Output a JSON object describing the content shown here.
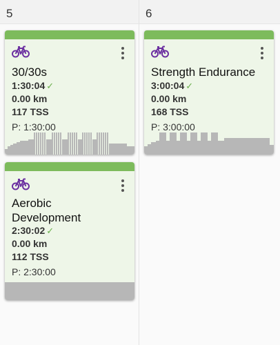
{
  "days": [
    {
      "label": "5"
    },
    {
      "label": "6"
    }
  ],
  "colors": {
    "accent": "#7dbb5c",
    "icon": "#6b2fa0",
    "check": "#6ab04c",
    "chart": "#b7b7b7"
  },
  "workouts": [
    {
      "icon": "bike-icon",
      "title": "30/30s",
      "duration": "1:30:04",
      "distance": "0.00 km",
      "tss": "117 TSS",
      "planned": "P: 1:30:00"
    },
    {
      "icon": "bike-icon",
      "title": "Strength Endurance",
      "duration": "3:00:04",
      "distance": "0.00 km",
      "tss": "168 TSS",
      "planned": "P: 3:00:00"
    },
    {
      "icon": "bike-icon",
      "title_line1": "Aerobic",
      "title_line2": "Development",
      "duration": "2:30:02",
      "distance": "0.00 km",
      "tss": "112 TSS",
      "planned": "P: 2:30:00"
    }
  ]
}
